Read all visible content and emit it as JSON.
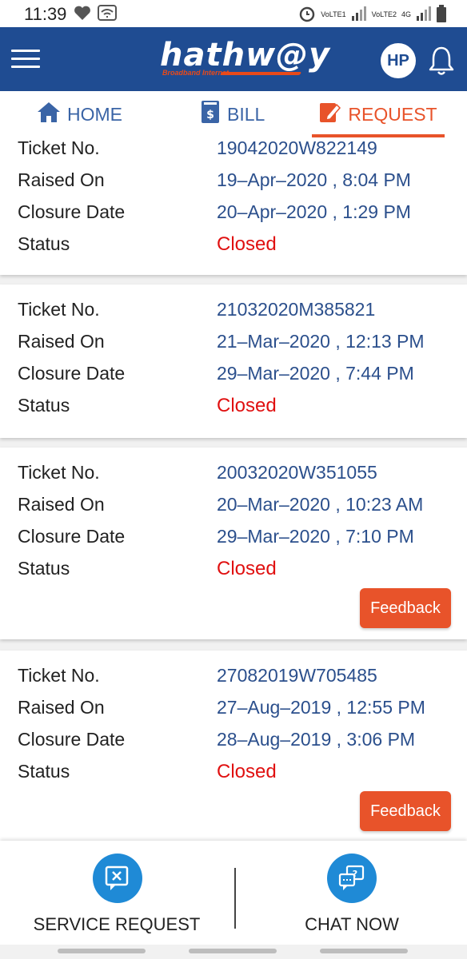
{
  "status_bar": {
    "time": "11:39",
    "left_icons": [
      "heart-icon",
      "wifi-icon"
    ],
    "right_icons": [
      "alarm-icon",
      "volte1-signal-icon",
      "volte2-signal-icon",
      "battery-icon"
    ],
    "volte1": "VoLTE1",
    "volte2": "VoLTE2",
    "net": "4G"
  },
  "app_bar": {
    "logo_text": "hathw@y",
    "logo_sub": "Broadband Internet",
    "avatar_initials": "HP"
  },
  "tabs": [
    {
      "label": "HOME",
      "icon": "home-icon",
      "active": false
    },
    {
      "label": "BILL",
      "icon": "bill-icon",
      "active": false
    },
    {
      "label": "REQUEST",
      "icon": "edit-icon",
      "active": true
    }
  ],
  "labels": {
    "ticket_no": "Ticket No.",
    "raised_on": "Raised On",
    "closure_date": "Closure Date",
    "status": "Status",
    "feedback": "Feedback"
  },
  "tickets": [
    {
      "ticket_no": "19042020W822149",
      "raised_on": "19–Apr–2020 , 8:04 PM",
      "closure_date": "20–Apr–2020 , 1:29 PM",
      "status": "Closed",
      "feedback": false
    },
    {
      "ticket_no": "21032020M385821",
      "raised_on": "21–Mar–2020 , 12:13 PM",
      "closure_date": "29–Mar–2020 , 7:44 PM",
      "status": "Closed",
      "feedback": false
    },
    {
      "ticket_no": "20032020W351055",
      "raised_on": "20–Mar–2020 , 10:23 AM",
      "closure_date": "29–Mar–2020 , 7:10 PM",
      "status": "Closed",
      "feedback": true
    },
    {
      "ticket_no": "27082019W705485",
      "raised_on": "27–Aug–2019 , 12:55 PM",
      "closure_date": "28–Aug–2019 , 3:06 PM",
      "status": "Closed",
      "feedback": true
    }
  ],
  "bottom_bar": {
    "service_request": "SERVICE REQUEST",
    "chat_now": "CHAT NOW"
  },
  "colors": {
    "brand_blue": "#1f4c92",
    "accent_orange": "#e8532a",
    "status_closed": "#e01010",
    "value_blue": "#2b4f8c",
    "action_blue": "#1f8ad6"
  }
}
